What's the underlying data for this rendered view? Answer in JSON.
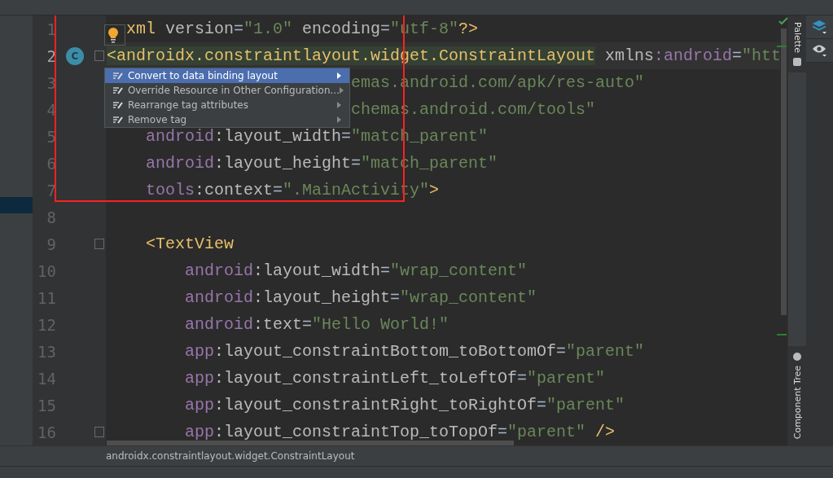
{
  "editor": {
    "lines": [
      {
        "number": "1",
        "current": false,
        "kind": "after_bulb",
        "fold": false,
        "tokens": [
          {
            "kind": "tag",
            "text": "xml "
          },
          {
            "kind": "attr",
            "text": "version"
          },
          {
            "kind": "punct",
            "text": "="
          },
          {
            "kind": "value",
            "text": "\"1.0\""
          },
          {
            "kind": "attr",
            "text": " encoding"
          },
          {
            "kind": "punct",
            "text": "="
          },
          {
            "kind": "value",
            "text": "\"utf-8\""
          },
          {
            "kind": "tag",
            "text": "?>"
          }
        ]
      },
      {
        "number": "2",
        "current": true,
        "fold": true,
        "badge": "C",
        "tokens": [
          {
            "kind": "tag",
            "text": "<androidx.constraintlayout.widget.ConstraintLayout"
          },
          {
            "kind": "attr",
            "text": " xmlns"
          },
          {
            "kind": "ns",
            "text": ":android"
          },
          {
            "kind": "punct",
            "text": "="
          },
          {
            "kind": "value",
            "text": "\"htt"
          }
        ]
      },
      {
        "number": "3",
        "current": false,
        "kind": "after_menu",
        "fold": false,
        "tokens": [
          {
            "kind": "value",
            "text": "emas.android.com/apk/res-auto\""
          }
        ]
      },
      {
        "number": "4",
        "current": false,
        "kind": "after_menu",
        "fold": false,
        "tokens": [
          {
            "kind": "value",
            "text": "chemas.android.com/tools\""
          }
        ]
      },
      {
        "number": "5",
        "current": false,
        "fold": false,
        "tokens": [
          {
            "kind": "ns",
            "text": "    android"
          },
          {
            "kind": "attr",
            "text": ":layout_width"
          },
          {
            "kind": "punct",
            "text": "="
          },
          {
            "kind": "value",
            "text": "\"match_parent\""
          }
        ]
      },
      {
        "number": "6",
        "current": false,
        "fold": false,
        "tokens": [
          {
            "kind": "ns",
            "text": "    android"
          },
          {
            "kind": "attr",
            "text": ":layout_height"
          },
          {
            "kind": "punct",
            "text": "="
          },
          {
            "kind": "value",
            "text": "\"match_parent\""
          }
        ]
      },
      {
        "number": "7",
        "current": false,
        "fold": false,
        "tokens": [
          {
            "kind": "ns",
            "text": "    tools"
          },
          {
            "kind": "attr",
            "text": ":context"
          },
          {
            "kind": "punct",
            "text": "="
          },
          {
            "kind": "value",
            "text": "\".MainActivity\""
          },
          {
            "kind": "tag",
            "text": ">"
          }
        ]
      },
      {
        "number": "8",
        "current": false,
        "fold": false
      },
      {
        "number": "9",
        "current": false,
        "fold": true,
        "tokens": [
          {
            "kind": "tag",
            "text": "    <TextView"
          }
        ]
      },
      {
        "number": "10",
        "current": false,
        "fold": false,
        "tokens": [
          {
            "kind": "ns",
            "text": "        android"
          },
          {
            "kind": "attr",
            "text": ":layout_width"
          },
          {
            "kind": "punct",
            "text": "="
          },
          {
            "kind": "value",
            "text": "\"wrap_content\""
          }
        ]
      },
      {
        "number": "11",
        "current": false,
        "fold": false,
        "tokens": [
          {
            "kind": "ns",
            "text": "        android"
          },
          {
            "kind": "attr",
            "text": ":layout_height"
          },
          {
            "kind": "punct",
            "text": "="
          },
          {
            "kind": "value",
            "text": "\"wrap_content\""
          }
        ]
      },
      {
        "number": "12",
        "current": false,
        "fold": false,
        "tokens": [
          {
            "kind": "ns",
            "text": "        android"
          },
          {
            "kind": "attr",
            "text": ":text"
          },
          {
            "kind": "punct",
            "text": "="
          },
          {
            "kind": "value",
            "text": "\"Hello World!\""
          }
        ]
      },
      {
        "number": "13",
        "current": false,
        "fold": false,
        "tokens": [
          {
            "kind": "ns",
            "text": "        app"
          },
          {
            "kind": "attr",
            "text": ":layout_constraintBottom_toBottomOf"
          },
          {
            "kind": "punct",
            "text": "="
          },
          {
            "kind": "value",
            "text": "\"parent\""
          }
        ]
      },
      {
        "number": "14",
        "current": false,
        "fold": false,
        "tokens": [
          {
            "kind": "ns",
            "text": "        app"
          },
          {
            "kind": "attr",
            "text": ":layout_constraintLeft_toLeftOf"
          },
          {
            "kind": "punct",
            "text": "="
          },
          {
            "kind": "value",
            "text": "\"parent\""
          }
        ]
      },
      {
        "number": "15",
        "current": false,
        "fold": false,
        "tokens": [
          {
            "kind": "ns",
            "text": "        app"
          },
          {
            "kind": "attr",
            "text": ":layout_constraintRight_toRightOf"
          },
          {
            "kind": "punct",
            "text": "="
          },
          {
            "kind": "value",
            "text": "\"parent\""
          }
        ]
      },
      {
        "number": "16",
        "current": false,
        "fold": true,
        "tokens": [
          {
            "kind": "ns",
            "text": "        app"
          },
          {
            "kind": "attr",
            "text": ":layout_constraintTop_toTopOf"
          },
          {
            "kind": "punct",
            "text": "="
          },
          {
            "kind": "value",
            "text": "\"parent\""
          },
          {
            "kind": "tag",
            "text": " />"
          }
        ]
      }
    ]
  },
  "intention_menu": {
    "items": [
      {
        "label": "Convert to data binding layout",
        "selected": true
      },
      {
        "label": "Override Resource in Other Configuration...",
        "selected": false
      },
      {
        "label": "Rearrange tag attributes",
        "selected": false
      },
      {
        "label": "Remove tag",
        "selected": false
      }
    ]
  },
  "side_tabs": [
    {
      "label": "Palette",
      "kind": "top"
    },
    {
      "label": "Component Tree",
      "kind": "bottom"
    }
  ],
  "breadcrumb": "androidx.constraintlayout.widget.ConstraintLayout"
}
